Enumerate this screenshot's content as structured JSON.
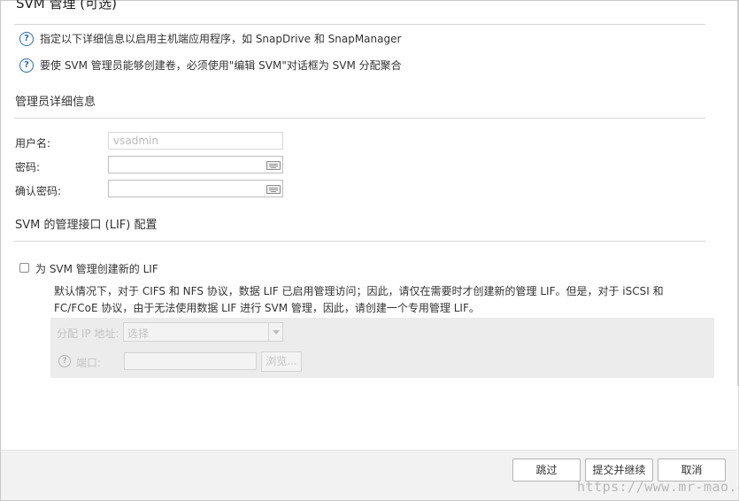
{
  "dialog": {
    "title": "SVM 管理 (可选)"
  },
  "info": {
    "line1": "指定以下详细信息以启用主机端应用程序，如 SnapDrive 和 SnapManager",
    "line2": "要使 SVM 管理员能够创建卷，必须使用\"编辑 SVM\"对话框为 SVM 分配聚合"
  },
  "admin_details": {
    "section_title": "管理员详细信息",
    "username_label": "用户名:",
    "username_value": "vsadmin",
    "password_label": "密码:",
    "password_value": "",
    "confirm_label": "确认密码:",
    "confirm_value": ""
  },
  "lif_config": {
    "section_title": "SVM 的管理接口 (LIF) 配置",
    "checkbox_label": "为 SVM 管理创建新的 LIF",
    "checkbox_checked": false,
    "description": "默认情况下，对于 CIFS 和 NFS 协议，数据 LIF 已启用管理访问；因此，请仅在需要时才创建新的管理 LIF。但是，对于 iSCSI 和 FC/FCoE 协议，由于无法使用数据 LIF 进行 SVM 管理，因此，请创建一个专用管理 LIF。",
    "assign_ip_label": "分配 IP 地址:",
    "assign_ip_selected": "选择",
    "port_label": "端口:",
    "port_value": "",
    "browse_label": "浏览..."
  },
  "footer": {
    "skip_label": "跳过",
    "submit_label": "提交并继续",
    "cancel_label": "取消"
  },
  "watermark": "https://www.mr-mao.cn",
  "colors": {
    "accent_blue": "#2a6cb3",
    "footer_bg": "#f2f2f2",
    "disabled_panel_bg": "#ececec"
  },
  "icons": {
    "help": "help-circle-icon",
    "keyboard": "keyboard-icon"
  }
}
